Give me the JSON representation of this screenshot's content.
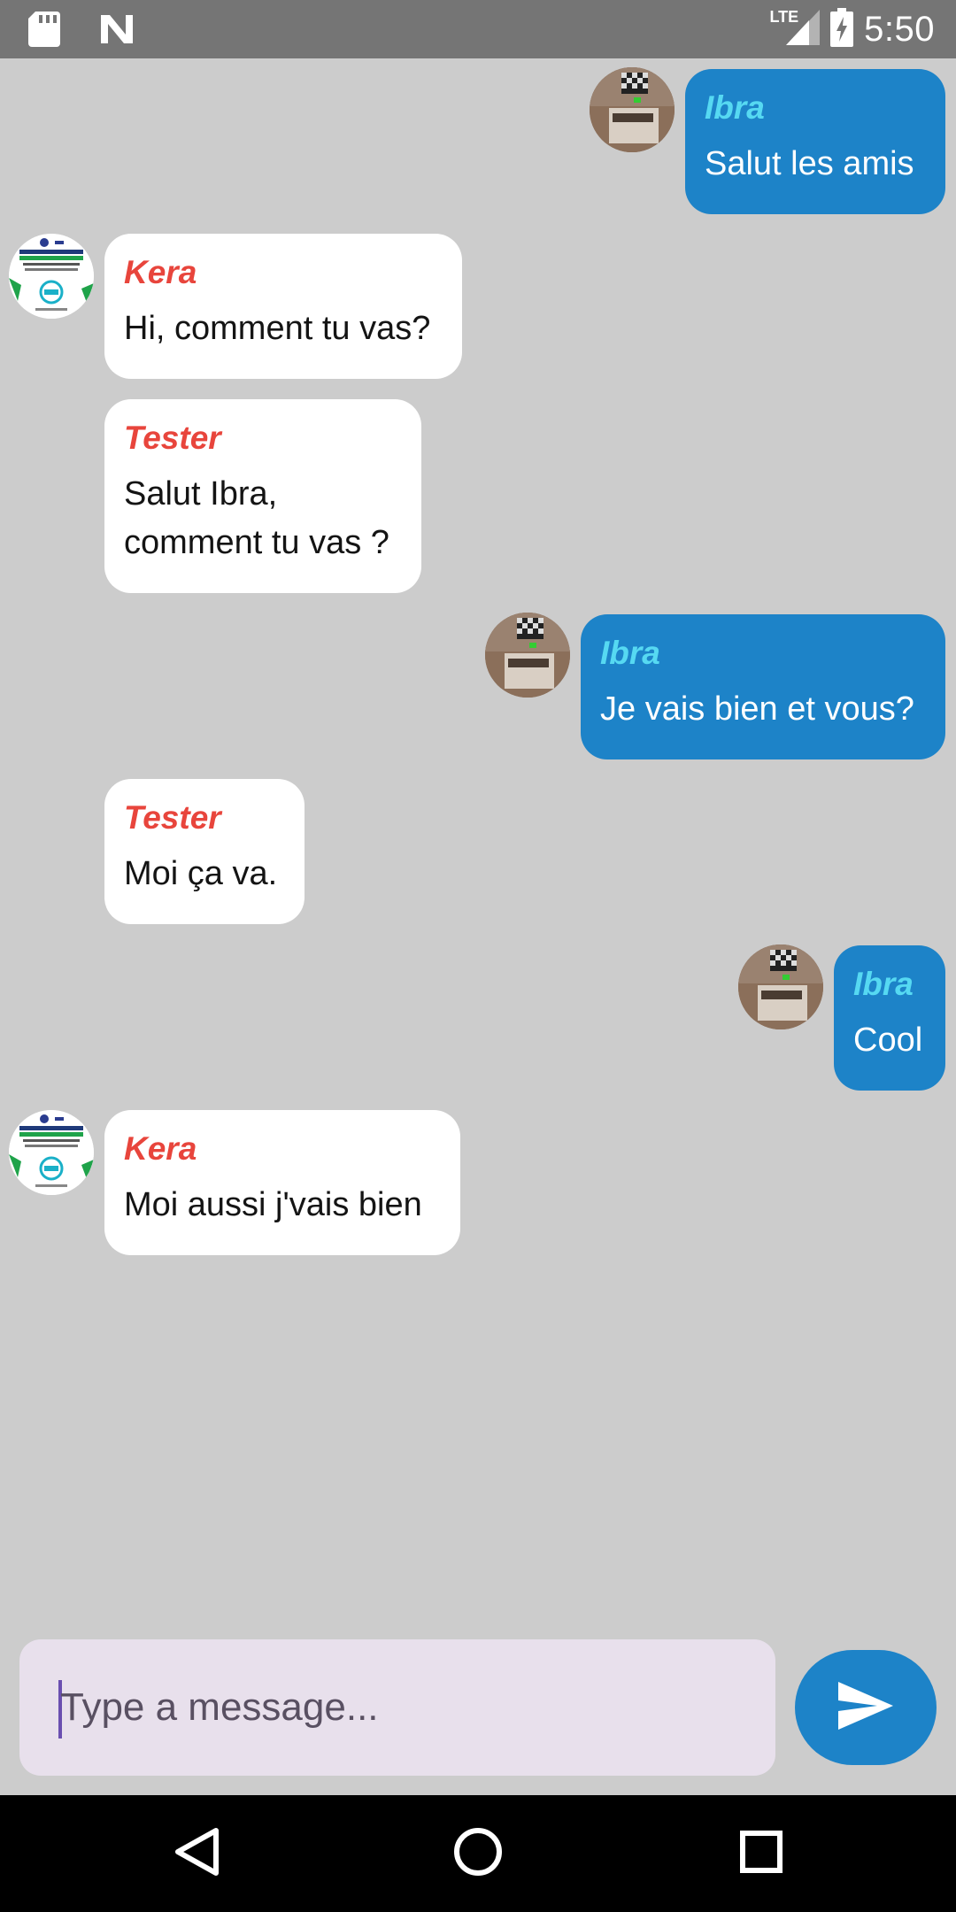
{
  "status_bar": {
    "time": "5:50",
    "network": "LTE",
    "icons": [
      "sd-card-icon",
      "n-logo-icon",
      "signal-icon",
      "battery-charging-icon"
    ]
  },
  "messages": [
    {
      "sender": "Ibra",
      "text": "Salut les amis",
      "direction": "outgoing",
      "avatar": "ibra-avatar"
    },
    {
      "sender": "Kera",
      "text": "Hi, comment tu vas?",
      "direction": "incoming",
      "avatar": "kera-avatar"
    },
    {
      "sender": "Tester",
      "text": "Salut Ibra,\ncomment tu vas ?",
      "direction": "incoming",
      "avatar": ""
    },
    {
      "sender": "Ibra",
      "text": "Je vais bien et vous?",
      "direction": "outgoing",
      "avatar": "ibra-avatar"
    },
    {
      "sender": "Tester",
      "text": "Moi ça va.",
      "direction": "incoming",
      "avatar": ""
    },
    {
      "sender": "Ibra",
      "text": "Cool",
      "direction": "outgoing",
      "avatar": "ibra-avatar"
    },
    {
      "sender": "Kera",
      "text": "Moi aussi j'vais bien",
      "direction": "incoming",
      "avatar": "kera-avatar"
    }
  ],
  "composer": {
    "placeholder": "Type a message...",
    "value": "",
    "send_icon": "send-icon"
  },
  "nav_bar": {
    "icons": [
      "back-icon",
      "home-icon",
      "recents-icon"
    ]
  },
  "colors": {
    "background": "#cccccc",
    "outgoing_bubble": "#1d83c8",
    "incoming_bubble": "#ffffff",
    "incoming_sender": "#e8453c",
    "outgoing_sender": "#56d9f2"
  }
}
